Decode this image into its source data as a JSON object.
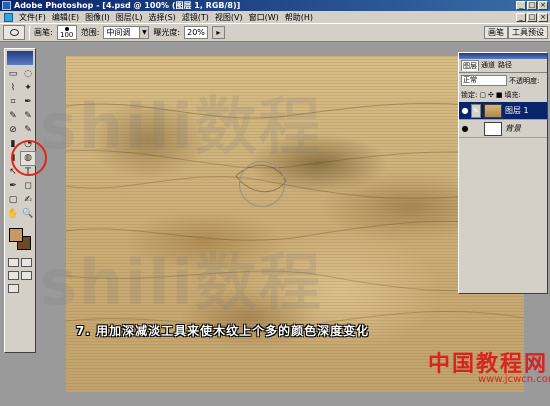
{
  "window": {
    "title": "Adobe Photoshop - [4.psd @ 100% (图层 1, RGB/8)]",
    "controls": [
      "_",
      "□",
      "×"
    ]
  },
  "menu": {
    "items": [
      "文件(F)",
      "编辑(E)",
      "图像(I)",
      "图层(L)",
      "选择(S)",
      "滤镜(T)",
      "视图(V)",
      "窗口(W)",
      "帮助(H)"
    ]
  },
  "options": {
    "brush_label": "画笔:",
    "brush_size": "100",
    "range_label": "范围:",
    "range_value": "中间调",
    "exposure_label": "曝光度:",
    "exposure_value": "20%",
    "tabs": [
      "画笔",
      "工具预设"
    ]
  },
  "toolbox": {
    "tools": [
      "▭",
      "◌",
      "⌇",
      "✦",
      "⌗",
      "✒",
      "✎",
      "✎",
      "⊘",
      "✎",
      "▮",
      "◔",
      "◖",
      "◍",
      "↖",
      "T",
      "✒",
      "◻",
      "▢",
      "✍",
      "✋",
      "🔍"
    ],
    "colors": {
      "foreground": "#c49a62",
      "background": "#6b4a24"
    }
  },
  "layers_panel": {
    "tabs": [
      "图层",
      "通道",
      "路径"
    ],
    "blend_mode": "正常",
    "opacity_label": "不透明度:",
    "lock_label": "锁定:",
    "fill_label": "填充:",
    "layers": [
      {
        "name": "图层 1",
        "selected": true
      },
      {
        "name": "背景",
        "selected": false
      }
    ]
  },
  "canvas": {
    "watermark": "shili数程",
    "caption": "7. 用加深减淡工具来使木纹上个多的颜色深度变化"
  },
  "branding": {
    "site_name": "中国教程网",
    "site_url": "www.jcwcn.com"
  }
}
